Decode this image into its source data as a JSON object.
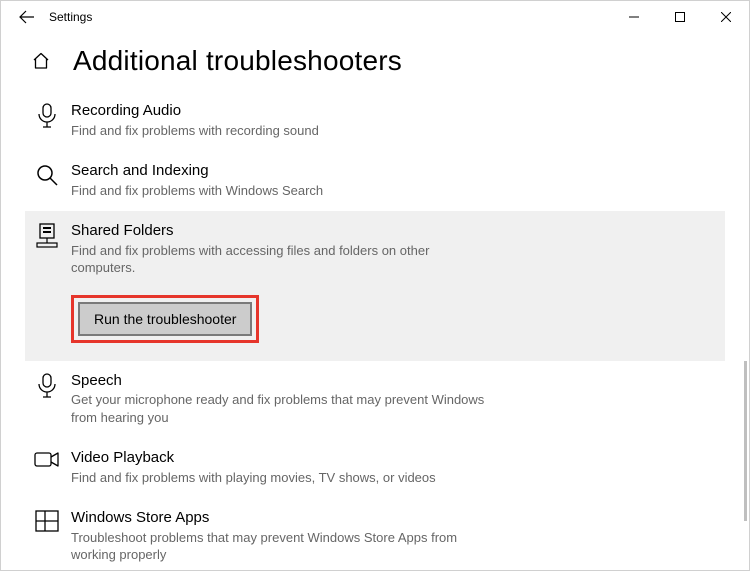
{
  "window": {
    "title": "Settings"
  },
  "header": {
    "page_title": "Additional troubleshooters"
  },
  "items": {
    "recording": {
      "title": "Recording Audio",
      "desc": "Find and fix problems with recording sound"
    },
    "search": {
      "title": "Search and Indexing",
      "desc": "Find and fix problems with Windows Search"
    },
    "shared": {
      "title": "Shared Folders",
      "desc": "Find and fix problems with accessing files and folders on other computers.",
      "run_label": "Run the troubleshooter"
    },
    "speech": {
      "title": "Speech",
      "desc": "Get your microphone ready and fix problems that may prevent Windows from hearing you"
    },
    "video": {
      "title": "Video Playback",
      "desc": "Find and fix problems with playing movies, TV shows, or videos"
    },
    "store": {
      "title": "Windows Store Apps",
      "desc": "Troubleshoot problems that may prevent Windows Store Apps from working properly"
    }
  }
}
